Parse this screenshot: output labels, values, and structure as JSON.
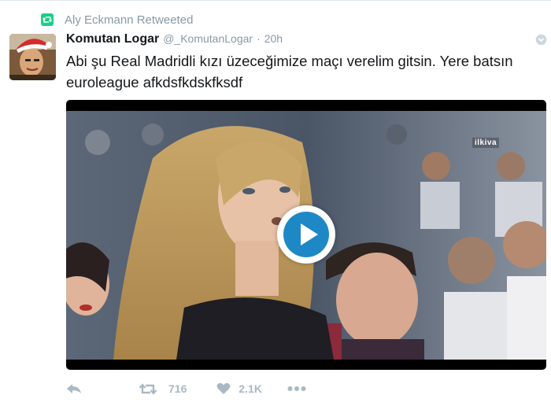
{
  "retweet_context": {
    "text": "Aly Eckmann Retweeted",
    "icon": "retweet-icon"
  },
  "tweet": {
    "author": {
      "fullname": "Komutan Logar",
      "username": "@_KomutanLogar",
      "separator": "·",
      "time": "20h"
    },
    "text_line1": "Abi şu Real Madridli kızı üzeceğimize maçı verelim gitsin. Yere batsın",
    "text_line2": "euroleague afkdsfkdskfksdf",
    "media": {
      "watermark": "ilkiva",
      "play_icon": "play-icon"
    },
    "actions": {
      "reply_icon": "reply-icon",
      "retweet_icon": "retweet-icon",
      "retweet_count": "716",
      "like_icon": "heart-icon",
      "like_count": "2.1K",
      "more_icon": "more-icon"
    }
  },
  "colors": {
    "retweet_green": "#19cf86",
    "muted_gray": "#8899a6",
    "action_gray": "#aab8c2",
    "play_blue": "#1e88c7"
  }
}
